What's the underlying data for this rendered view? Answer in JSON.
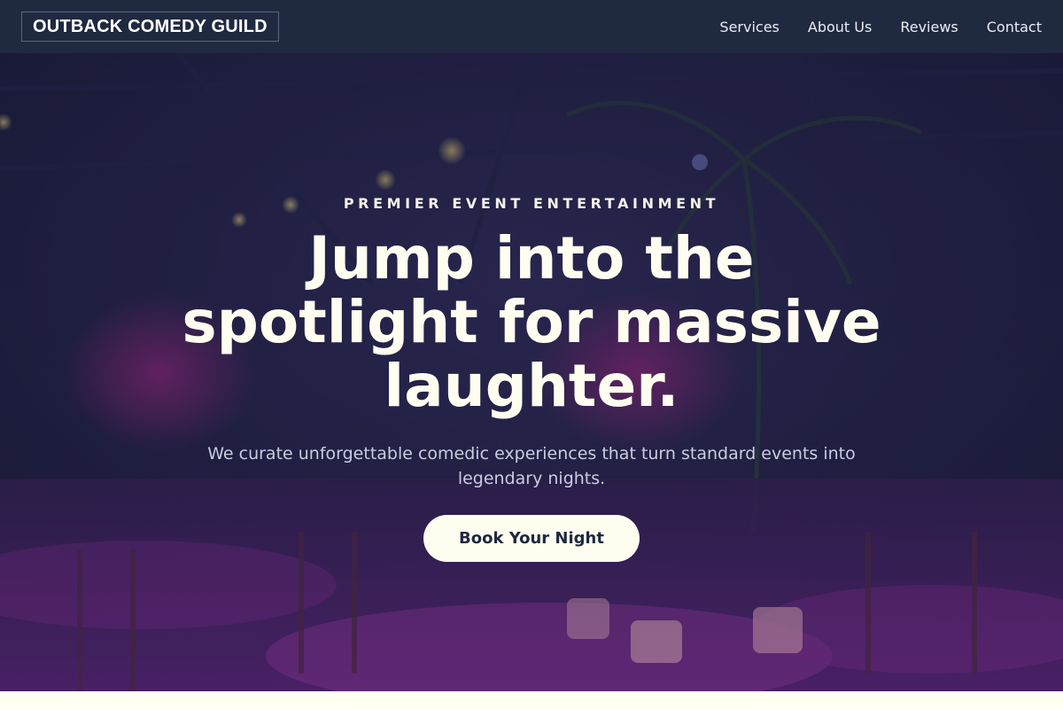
{
  "header": {
    "logo": "OUTBACK COMEDY GUILD",
    "nav": [
      {
        "label": "Services"
      },
      {
        "label": "About Us"
      },
      {
        "label": "Reviews"
      },
      {
        "label": "Contact"
      }
    ]
  },
  "hero": {
    "eyebrow": "PREMIER EVENT ENTERTAINMENT",
    "headline": "Jump into the spotlight for massive laughter.",
    "subtitle": "We curate unforgettable comedic experiences that turn standard events into legendary nights.",
    "cta": "Book Your Night"
  },
  "colors": {
    "header_bg": "#1f2940",
    "accent_cream": "#fffdf0",
    "hero_tint": "#2a2458"
  }
}
